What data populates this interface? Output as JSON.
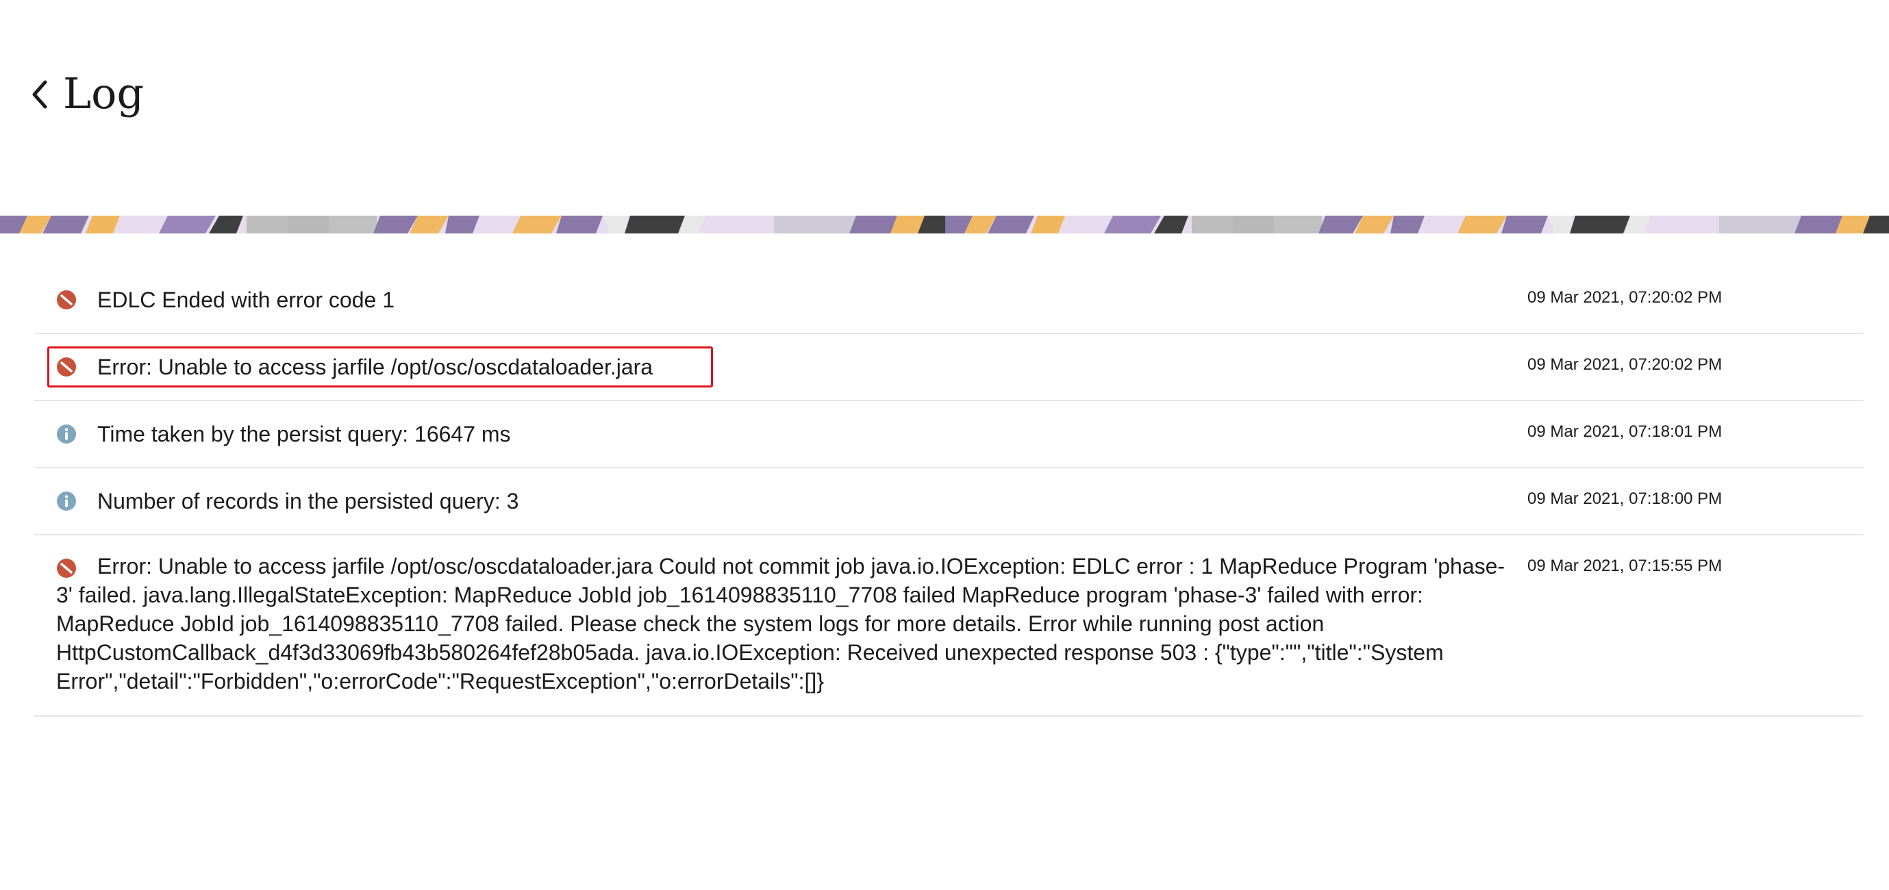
{
  "header": {
    "title": "Log",
    "back_icon": "chevron-left-icon"
  },
  "colors": {
    "error": "#c6523a",
    "info": "#7fa6bd",
    "highlight": "#e0131f",
    "divider": "#e6e6e6"
  },
  "logs": [
    {
      "status": "error",
      "icon": "error-icon",
      "message": "EDLC Ended with error code 1",
      "timestamp": "09 Mar 2021, 07:20:02 PM"
    },
    {
      "status": "error",
      "icon": "error-icon",
      "message": "Error: Unable to access jarfile /opt/osc/oscdataloader.jara",
      "timestamp": "09 Mar 2021, 07:20:02 PM",
      "highlighted": true
    },
    {
      "status": "info",
      "icon": "info-icon",
      "message": "Time taken by the persist query: 16647 ms",
      "timestamp": "09 Mar 2021, 07:18:01 PM"
    },
    {
      "status": "info",
      "icon": "info-icon",
      "message": "Number of records in the persisted query: 3",
      "timestamp": "09 Mar 2021, 07:18:00 PM"
    },
    {
      "status": "error",
      "icon": "error-icon",
      "message": "Error: Unable to access jarfile /opt/osc/oscdataloader.jara Could not commit job java.io.IOException: EDLC error : 1 MapReduce Program 'phase-3' failed. java.lang.IllegalStateException: MapReduce JobId job_1614098835110_7708 failed MapReduce program 'phase-3' failed with error: MapReduce JobId job_1614098835110_7708 failed. Please check the system logs for more details. Error while running post action HttpCustomCallback_d4f3d33069fb43b580264fef28b05ada. java.io.IOException: Received unexpected response 503 : {\"type\":\"\",\"title\":\"System Error\",\"detail\":\"Forbidden\",\"o:errorCode\":\"RequestException\",\"o:errorDetails\":[]}",
      "timestamp": "09 Mar 2021, 07:15:55 PM"
    }
  ]
}
